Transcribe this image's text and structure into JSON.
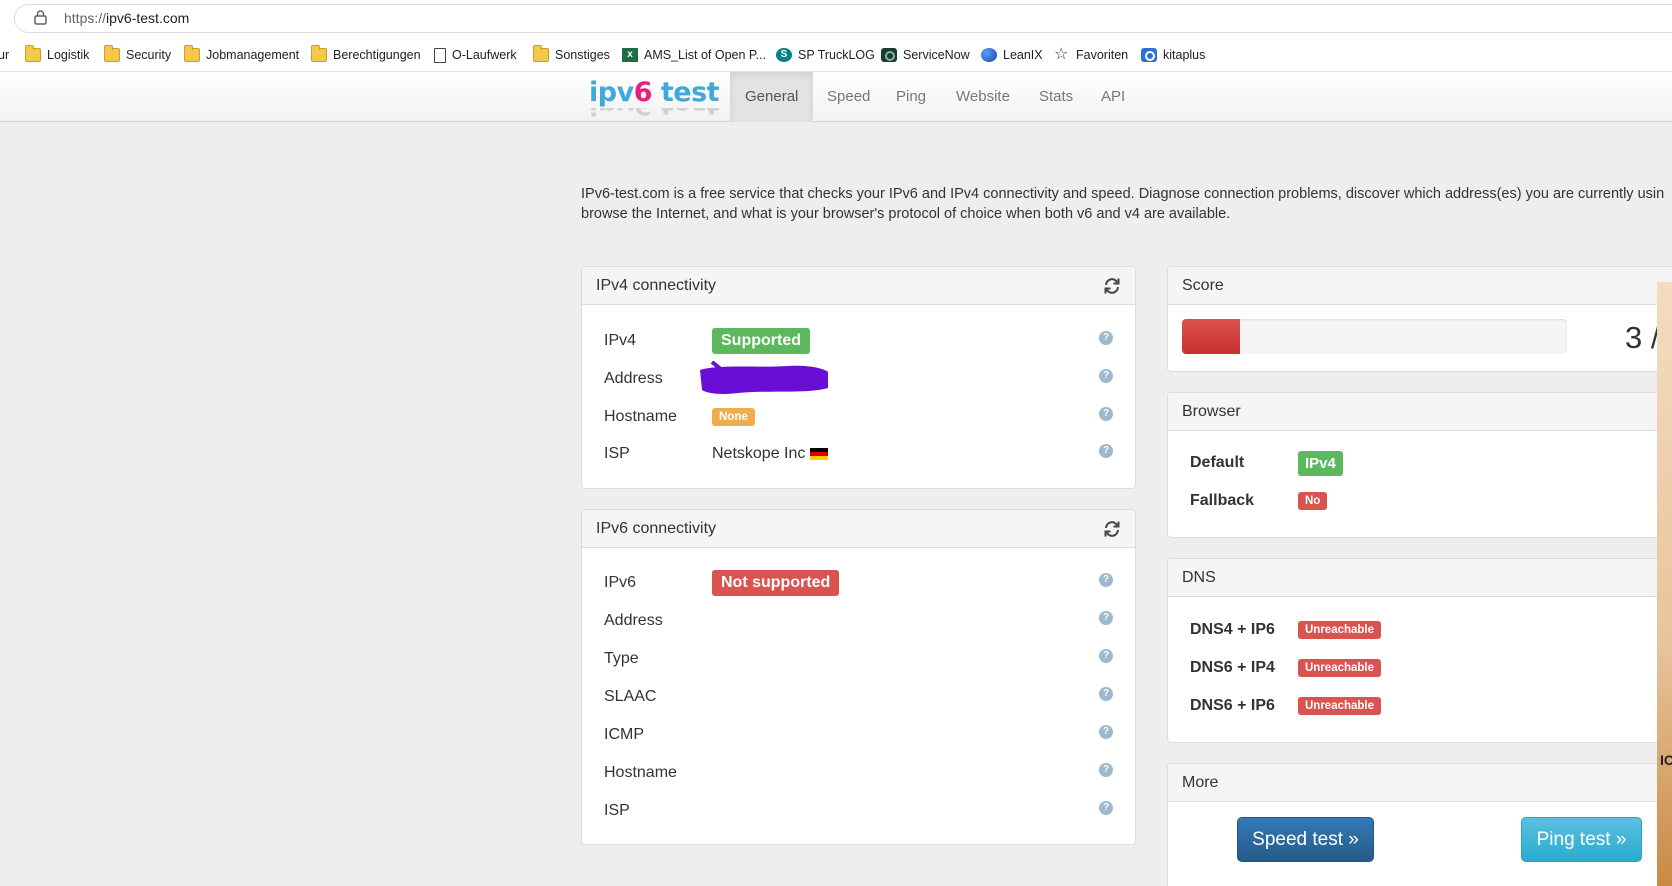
{
  "browser": {
    "url_scheme": "https://",
    "url_host": "ipv6-test.com",
    "bookmarks": [
      {
        "label": "ur",
        "icon": "none"
      },
      {
        "label": "Logistik",
        "icon": "folder-icon"
      },
      {
        "label": "Security",
        "icon": "folder-icon"
      },
      {
        "label": "Jobmanagement",
        "icon": "folder-icon"
      },
      {
        "label": "Berechtigungen",
        "icon": "folder-icon"
      },
      {
        "label": "O-Laufwerk",
        "icon": "page-icon"
      },
      {
        "label": "Sonstiges",
        "icon": "folder-icon"
      },
      {
        "label": "AMS_List of Open P...",
        "icon": "excel-icon"
      },
      {
        "label": "SP TruckLOG",
        "icon": "sharepoint-icon"
      },
      {
        "label": "ServiceNow",
        "icon": "servicenow-icon"
      },
      {
        "label": "LeanIX",
        "icon": "leanix-icon"
      },
      {
        "label": "Favoriten",
        "icon": "star-icon"
      },
      {
        "label": "kitaplus",
        "icon": "kitaplus-icon"
      }
    ]
  },
  "site": {
    "logo_prefix": "ipv",
    "logo_six": "6",
    "logo_suffix": " test",
    "nav": [
      {
        "label": "General",
        "active": true
      },
      {
        "label": "Speed",
        "active": false
      },
      {
        "label": "Ping",
        "active": false
      },
      {
        "label": "Website",
        "active": false
      },
      {
        "label": "Stats",
        "active": false
      },
      {
        "label": "API",
        "active": false
      }
    ]
  },
  "intro": {
    "line1": "IPv6-test.com is a free service that checks your IPv6 and IPv4 connectivity and speed. Diagnose connection problems, discover which address(es) you are currently usin",
    "line2": "browse the Internet, and what is your browser's protocol of choice when both v6 and v4 are available."
  },
  "ipv4": {
    "title": "IPv4 connectivity",
    "rows": {
      "ipv4": {
        "label": "IPv4",
        "value": "Supported"
      },
      "address": {
        "label": "Address",
        "value": ""
      },
      "hostname": {
        "label": "Hostname",
        "value": "None"
      },
      "isp": {
        "label": "ISP",
        "value": "Netskope Inc"
      }
    }
  },
  "ipv6": {
    "title": "IPv6 connectivity",
    "rows": {
      "ipv6": {
        "label": "IPv6",
        "value": "Not supported"
      },
      "address": {
        "label": "Address"
      },
      "type": {
        "label": "Type"
      },
      "slaac": {
        "label": "SLAAC"
      },
      "icmp": {
        "label": "ICMP"
      },
      "hostname": {
        "label": "Hostname"
      },
      "isp": {
        "label": "ISP"
      }
    }
  },
  "score": {
    "title": "Score",
    "text": "3 /",
    "fraction": 0.15
  },
  "browser_panel": {
    "title": "Browser",
    "default_label": "Default",
    "default_value": "IPv4",
    "fallback_label": "Fallback",
    "fallback_value": "No"
  },
  "dns": {
    "title": "DNS",
    "rows": [
      {
        "label": "DNS4 + IP6",
        "value": "Unreachable"
      },
      {
        "label": "DNS6 + IP4",
        "value": "Unreachable"
      },
      {
        "label": "DNS6 + IP6",
        "value": "Unreachable"
      }
    ]
  },
  "more": {
    "title": "More",
    "speed_button": "Speed test »",
    "ping_button": "Ping test »"
  },
  "side_text": "IC",
  "colors": {
    "green": "#5cb85c",
    "red": "#d9534f",
    "orange": "#f0ad4e",
    "primary": "#337ab7",
    "info": "#5bc0de",
    "redaction": "#6a0dd6"
  }
}
